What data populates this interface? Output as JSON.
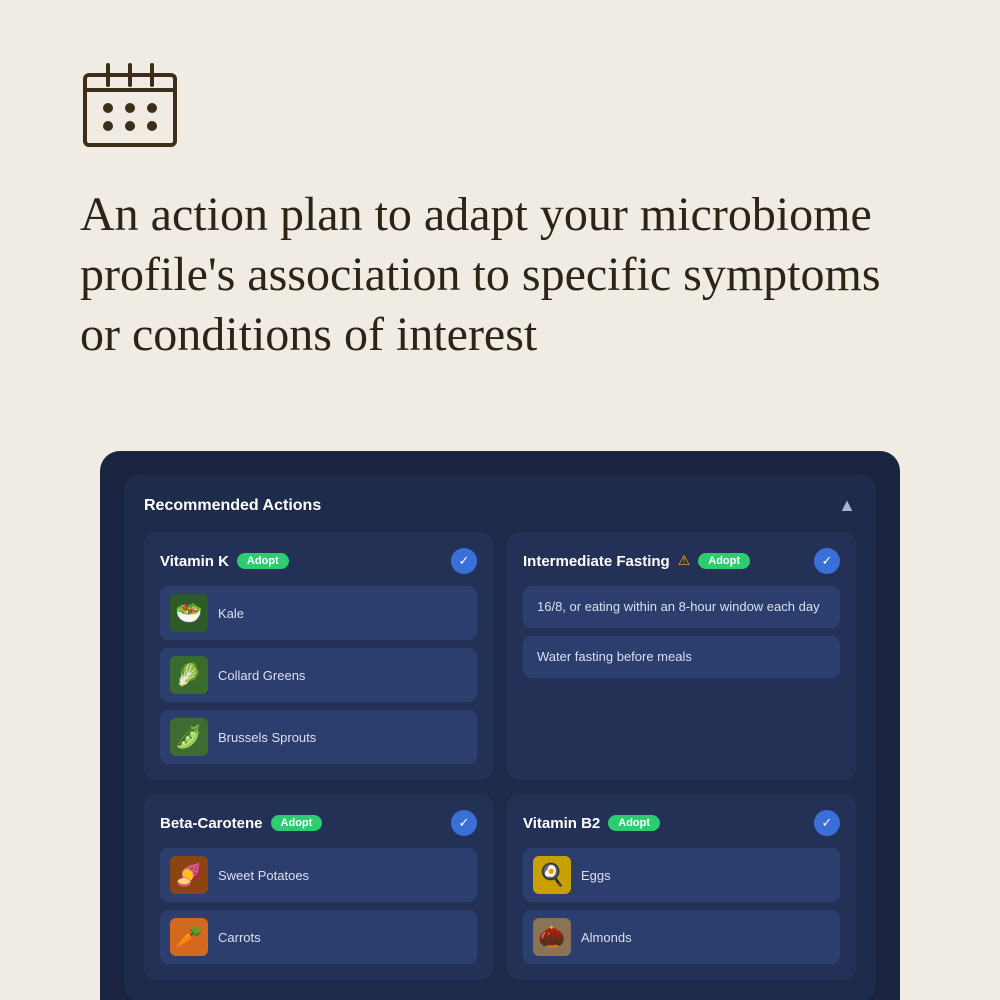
{
  "background_color": "#f0ece4",
  "icon": {
    "type": "calendar",
    "label": "calendar-icon"
  },
  "headline": "An action plan to adapt your microbiome profile's association to specific symptoms or conditions of interest",
  "panel": {
    "title": "Recommended Actions",
    "chevron": "▲",
    "cards": [
      {
        "id": "vitamin-k",
        "title": "Vitamin K",
        "badge": "Adopt",
        "checked": true,
        "warning": false,
        "type": "food",
        "items": [
          {
            "name": "Kale",
            "emoji": "🥗",
            "bg": "#2d5a27"
          },
          {
            "name": "Collard Greens",
            "emoji": "🥬",
            "bg": "#3a6b2e"
          },
          {
            "name": "Brussels Sprouts",
            "emoji": "🫛",
            "bg": "#3d6b30"
          }
        ]
      },
      {
        "id": "intermediate-fasting",
        "title": "Intermediate Fasting",
        "badge": "Adopt",
        "checked": true,
        "warning": true,
        "type": "text",
        "items": [
          {
            "text": "16/8, or eating within an 8-hour window each day"
          },
          {
            "text": "Water fasting before meals"
          }
        ]
      },
      {
        "id": "beta-carotene",
        "title": "Beta-Carotene",
        "badge": "Adopt",
        "checked": true,
        "warning": false,
        "type": "food",
        "items": [
          {
            "name": "Sweet Potatoes",
            "emoji": "🍠",
            "bg": "#8b4513"
          },
          {
            "name": "Carrots",
            "emoji": "🥕",
            "bg": "#d2691e"
          }
        ]
      },
      {
        "id": "vitamin-b2",
        "title": "Vitamin B2",
        "badge": "Adopt",
        "checked": true,
        "warning": false,
        "type": "food",
        "items": [
          {
            "name": "Eggs",
            "emoji": "🍳",
            "bg": "#c8a000"
          },
          {
            "name": "Almonds",
            "emoji": "🌰",
            "bg": "#8b7355"
          }
        ]
      }
    ]
  }
}
